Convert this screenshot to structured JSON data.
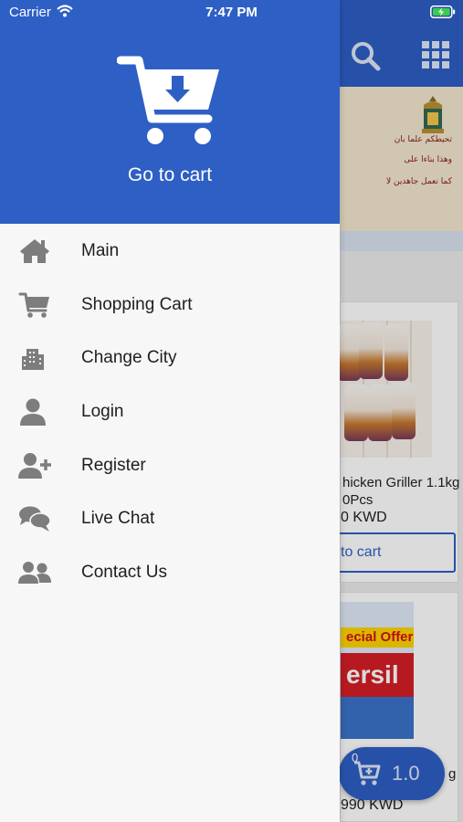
{
  "status_bar": {
    "carrier": "Carrier",
    "time": "7:47 PM"
  },
  "drawer": {
    "header": {
      "icon": "cart-download-icon",
      "label": "Go to cart"
    },
    "items": [
      {
        "label": "Main",
        "icon": "home-icon"
      },
      {
        "label": "Shopping Cart",
        "icon": "cart-icon"
      },
      {
        "label": "Change City",
        "icon": "city-icon"
      },
      {
        "label": "Login",
        "icon": "user-icon"
      },
      {
        "label": "Register",
        "icon": "user-plus-icon"
      },
      {
        "label": "Live Chat",
        "icon": "chat-icon"
      },
      {
        "label": "Contact Us",
        "icon": "users-icon"
      }
    ]
  },
  "background": {
    "banner_lines": [
      "تحيطكم علما بان",
      "وهذا بناءا على",
      "كما نعمل جاهدين لا"
    ],
    "product1": {
      "name": "hicken Griller 1.1kg",
      "qty": "0Pcs",
      "price": "0 KWD",
      "button": "to cart"
    },
    "product2": {
      "offer": "ecial Offer",
      "brand": "ersil",
      "name_fragment": "g",
      "price": "990 KWD"
    },
    "fab": {
      "count": "0",
      "total": "1.0"
    }
  },
  "colors": {
    "primary": "#2e5fc4",
    "drawer_bg": "#f7f7f7",
    "icon_gray": "#7d7d7d"
  }
}
